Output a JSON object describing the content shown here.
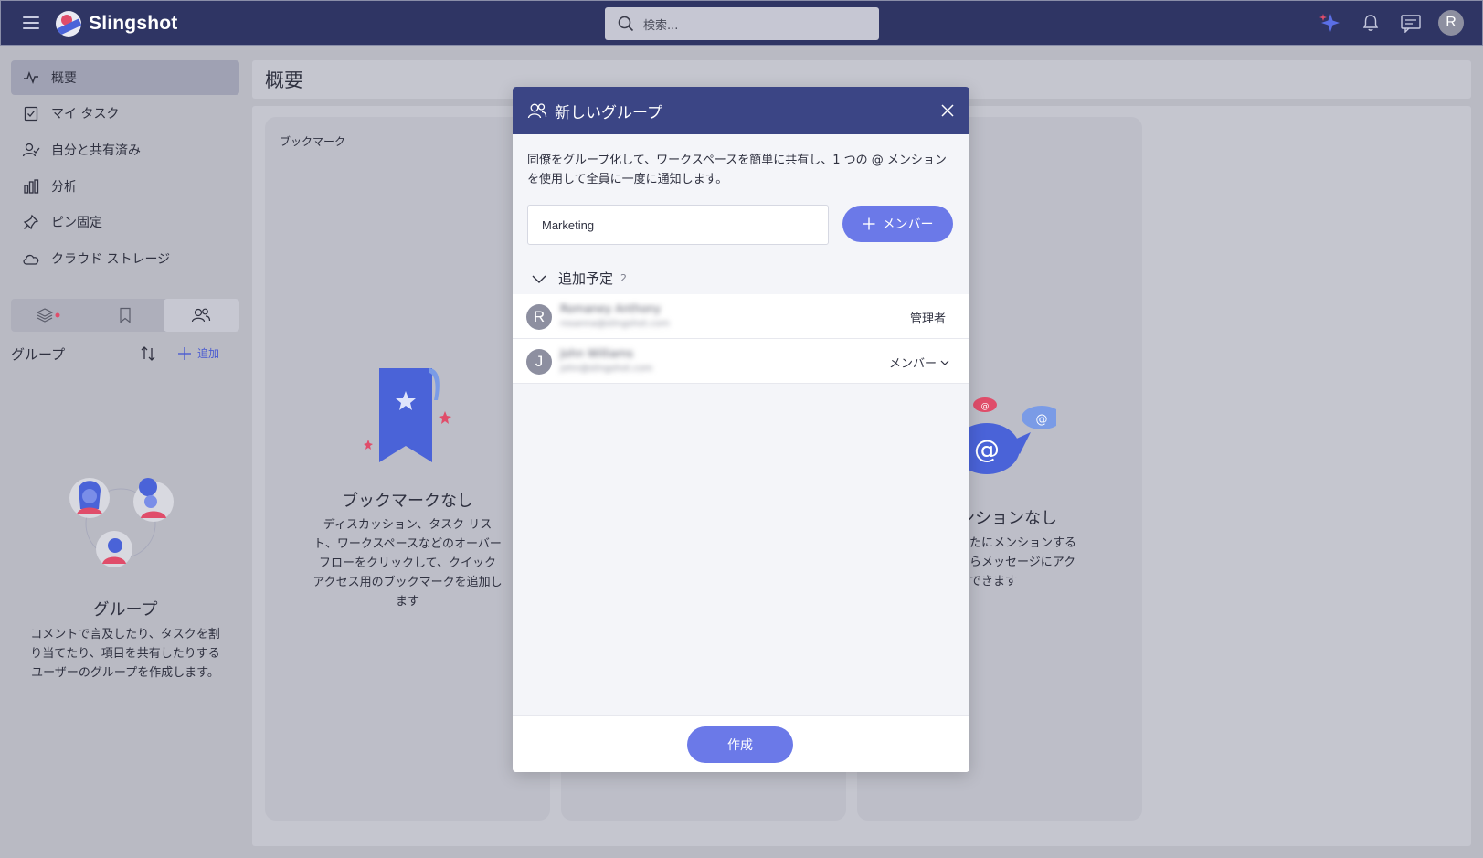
{
  "app": {
    "name": "Slingshot"
  },
  "header": {
    "search_placeholder": "検索..."
  },
  "sidebar": {
    "items": [
      {
        "label": "概要",
        "icon": "activity-icon"
      },
      {
        "label": "マイ タスク",
        "icon": "task-icon"
      },
      {
        "label": "自分と共有済み",
        "icon": "shared-user-icon"
      },
      {
        "label": "分析",
        "icon": "bar-chart-icon"
      },
      {
        "label": "ピン固定",
        "icon": "pin-icon"
      },
      {
        "label": "クラウド ストレージ",
        "icon": "cloud-icon"
      }
    ],
    "groups_title": "グループ",
    "add_label": "追加",
    "empty": {
      "title": "グループ",
      "desc": "コメントで言及したり、タスクを割り当てたり、項目を共有したりするユーザーのグループを作成します。"
    }
  },
  "main": {
    "title": "概要",
    "bookmarks_card": {
      "label": "ブックマーク",
      "title": "ブックマークなし",
      "desc": "ディスカッション、タスク リスト、ワークスペースなどのオーバーフローをクリックして、クイック アクセス用のブックマークを追加します"
    },
    "mentions_card": {
      "title": "ンションなし",
      "desc": "なたにメンションする\nからメッセージにアク\nスできます"
    }
  },
  "modal": {
    "title": "新しいグループ",
    "desc": "同僚をグループ化して、ワークスペースを簡単に共有し、1 つの @ メンションを使用して全員に一度に通知します。",
    "name_value": "Marketing",
    "add_member_label": "メンバー",
    "pending_label": "追加予定",
    "pending_count": "2",
    "members": [
      {
        "initial": "R",
        "name": "Romaney Anthony",
        "email": "rosanna@slingshot.com",
        "role": "管理者"
      },
      {
        "initial": "J",
        "name": "John Williams",
        "email": "john@slingshot.com",
        "role": "メンバー"
      }
    ],
    "create_label": "作成"
  },
  "colors": {
    "topbar": "#2f3564",
    "accent": "#6b79e8",
    "modal_header": "#3b4585"
  }
}
